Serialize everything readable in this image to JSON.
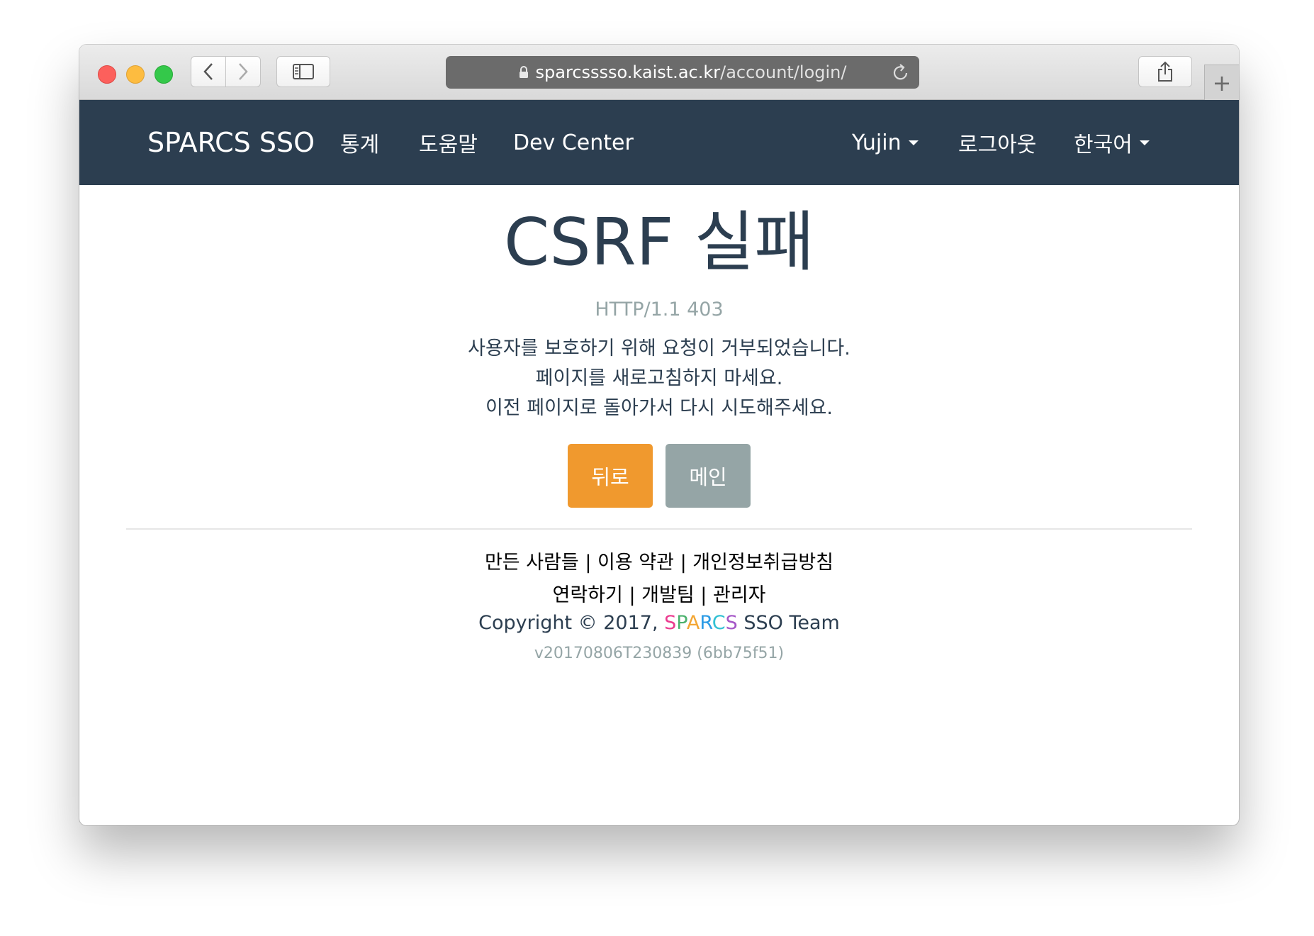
{
  "browser": {
    "url_host": "sparcsssso.kaist.ac.kr",
    "url_path": "/account/login/",
    "new_tab": "+"
  },
  "nav": {
    "brand": "SPARCS SSO",
    "stats": "통계",
    "help": "도움말",
    "dev_center": "Dev Center",
    "user": "Yujin",
    "logout": "로그아웃",
    "language": "한국어"
  },
  "error": {
    "title": "CSRF 실패",
    "status": "HTTP/1.1 403",
    "line1": "사용자를 보호하기 위해 요청이 거부되었습니다.",
    "line2": "페이지를 새로고침하지 마세요.",
    "line3": "이전 페이지로 돌아가서 다시 시도해주세요."
  },
  "buttons": {
    "back": "뒤로",
    "main": "메인"
  },
  "footer": {
    "makers": "만든 사람들",
    "terms": "이용 약관",
    "privacy": "개인정보취급방침",
    "contact": "연락하기",
    "dev_team": "개발팀",
    "admin": "관리자",
    "separator": "|",
    "copyright_prefix": "Copyright © 2017,",
    "sparcs_letters": [
      "S",
      "P",
      "A",
      "R",
      "C",
      "S"
    ],
    "copyright_suffix": "SSO Team",
    "version": "v20170806T230839 (6bb75f51)"
  },
  "colors": {
    "navbar": "#2c3e50",
    "back_button": "#f0992e",
    "main_button": "#95a5a6",
    "sparcs_letters": [
      "#eb3b8f",
      "#4cb26e",
      "#f3a633",
      "#2b9be5",
      "#30c1d3",
      "#a557c7"
    ]
  }
}
